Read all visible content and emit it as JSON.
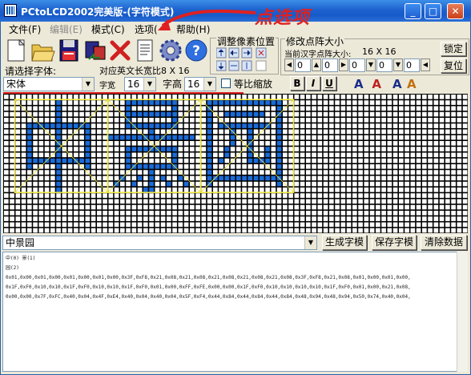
{
  "window": {
    "title": "PCtoLCD2002完美版-(字符模式)",
    "minimize": "_",
    "maximize": "□",
    "close": "✕"
  },
  "menu": {
    "items": [
      {
        "label": "文件(F)",
        "enabled": true
      },
      {
        "label": "编辑(E)",
        "enabled": false
      },
      {
        "label": "模式(C)",
        "enabled": true
      },
      {
        "label": "选项(",
        "enabled": true
      },
      {
        "label": "帮助(H)",
        "enabled": true
      }
    ]
  },
  "annotation": {
    "text": "点选项",
    "color": "#e02020"
  },
  "toolbar": {
    "icons": [
      "new-file-icon",
      "open-folder-icon",
      "save-disk-icon",
      "convert-icon",
      "delete-icon",
      "document-icon",
      "gear-icon",
      "help-icon"
    ]
  },
  "pixel_group": {
    "title": "调整像素位置"
  },
  "dot_group": {
    "title": "修改点阵大小",
    "current_size_label": "当前汉字点阵大小:",
    "current_size_value": "16  X  16",
    "lock_label": "锁定",
    "reset_label": "复位",
    "spin_values": [
      "0",
      "0",
      "0",
      "0",
      "0",
      "0"
    ]
  },
  "font": {
    "select_label": "请选择字体:",
    "font_value": "宋体",
    "en_width_label": "对应英文长宽比8 X 16",
    "width_label": "字宽",
    "width_value": "16",
    "height_label": "字高",
    "height_value": "16",
    "ratio_label": "等比缩放",
    "bold": "B",
    "italic": "I",
    "underline": "U"
  },
  "editor": {
    "text": "中景园",
    "generate_label": "生成字模",
    "save_label": "保存字模",
    "clear_label": "清除数据"
  },
  "output": {
    "lines": [
      "中(0) 景(1)",
      "园(2)",
      "0x01,0x00,0x01,0x00,0x01,0x00,0x01,0x00,0x3F,0xF8,0x21,0x08,0x21,0x08,0x21,0x08,0x21,0x08,0x21,0x08,0x3F,0xF8,0x21,0x08,0x01,0x00,0x01,0x00,",
      "0x1F,0xF0,0x10,0x10,0x1F,0xF0,0x10,0x10,0x1F,0xF0,0x01,0x00,0xFF,0xFE,0x00,0x00,0x1F,0xF0,0x10,0x10,0x10,0x10,0x1F,0xF0,0x01,0x00,0x21,0x08,",
      "0x00,0x00,0x7F,0xFC,0x40,0x04,0x4F,0xE4,0x40,0x04,0x40,0x04,0x5F,0xF4,0x44,0x84,0x44,0x84,0x44,0x84,0x48,0x94,0x48,0x94,0x50,0x74,0x40,0x04,"
    ]
  },
  "colors": {
    "pixel_on": "#1a6cd8",
    "pixel_off": "#ffffff",
    "grid_line": "#000000",
    "char_box": "#f0e63a",
    "underline_red": "#e02020"
  },
  "glyphs": {
    "zhong": [
      "0000000100000000",
      "0000000100000000",
      "0000000100000000",
      "0000000100000000",
      "0011111111111000",
      "0010000100001000",
      "0010000100001000",
      "0010000100001000",
      "0010000100001000",
      "0010000100001000",
      "0011111111111000",
      "0010000100001000",
      "0000000100000000",
      "0000000100000000",
      "0000000100000000",
      "0000000100000000"
    ],
    "jing": [
      "0001111111110000",
      "0001000000010000",
      "0001111111110000",
      "0001000000010000",
      "0001111111110000",
      "0000000100000000",
      "1111111111111110",
      "0000000000000000",
      "0001111111110000",
      "0001000000010000",
      "0001000000010000",
      "0001111111110000",
      "0000000100000000",
      "0010010101001000",
      "0100100100100100",
      "0000001100000000"
    ],
    "yuan": [
      "0111111111111100",
      "0100000000000100",
      "0100111111100100",
      "0100000000000100",
      "0101111111110100",
      "0100010010000100",
      "0100010010000100",
      "0100010010000100",
      "0100100010010100",
      "0100100010010100",
      "0101000011110100",
      "0100000000000100",
      "0100000000000100",
      "0111111111111100",
      "0100000000000100",
      "0000000000000000"
    ]
  }
}
